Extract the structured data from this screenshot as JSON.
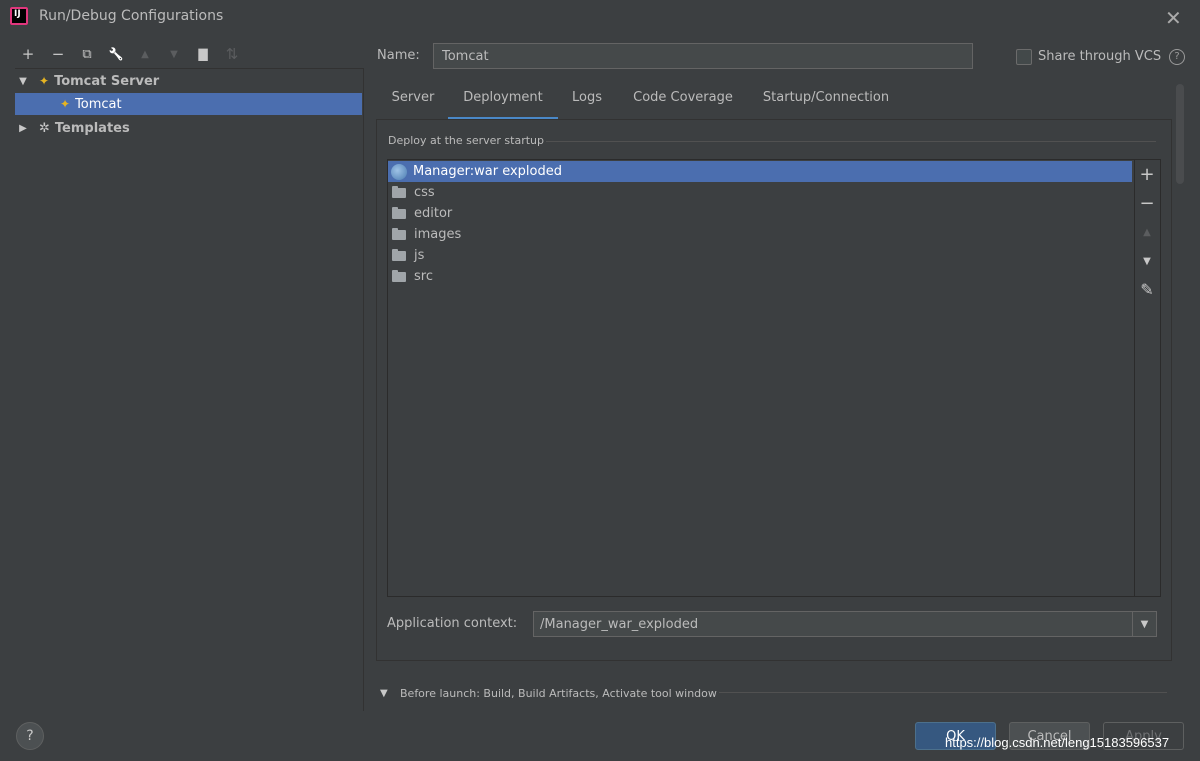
{
  "window": {
    "title": "Run/Debug Configurations"
  },
  "toolbar": {
    "add": "+",
    "remove": "−",
    "copy": "⧉",
    "edit_defaults": "🔧",
    "move_up": "▲",
    "move_down": "▼",
    "new_folder": "▇",
    "sort": "⇅"
  },
  "tree": {
    "items": [
      {
        "label": "Tomcat Server",
        "expanded": true,
        "arrow": "▼"
      },
      {
        "label": "Tomcat",
        "selected": true
      },
      {
        "label": "Templates",
        "expanded": false,
        "arrow": "▶"
      }
    ]
  },
  "name": {
    "label": "Name:",
    "value": "Tomcat"
  },
  "share": {
    "label": "Share through VCS",
    "checked": false,
    "help": "?"
  },
  "tabs": [
    {
      "label": "Server"
    },
    {
      "label": "Deployment",
      "active": true
    },
    {
      "label": "Logs"
    },
    {
      "label": "Code Coverage"
    },
    {
      "label": "Startup/Connection"
    }
  ],
  "deployment": {
    "section_title": "Deploy at the server startup",
    "items": [
      {
        "label": "Manager:war exploded",
        "icon": "artifact-icon",
        "selected": true
      },
      {
        "label": "css",
        "icon": "folder-icon"
      },
      {
        "label": "editor",
        "icon": "folder-icon"
      },
      {
        "label": "images",
        "icon": "folder-icon"
      },
      {
        "label": "js",
        "icon": "folder-icon"
      },
      {
        "label": "src",
        "icon": "folder-icon"
      }
    ],
    "side_tools": {
      "add": "+",
      "remove": "−",
      "up": "▲",
      "down": "▼",
      "edit": "✎"
    }
  },
  "app_context": {
    "label": "Application context:",
    "value": "/Manager_war_exploded",
    "dropdown": "▼"
  },
  "before_launch": {
    "arrow": "▼",
    "label": "Before launch: Build, Build Artifacts, Activate tool window"
  },
  "buttons": {
    "help": "?",
    "ok": "OK",
    "cancel": "Cancel",
    "apply": "Apply"
  },
  "watermark": "https://blog.csdn.net/leng15183596537",
  "colors": {
    "selection": "#4b6eaf",
    "background": "#3c3f41",
    "tab_underline": "#4a88c7",
    "ok_button": "#365880"
  }
}
